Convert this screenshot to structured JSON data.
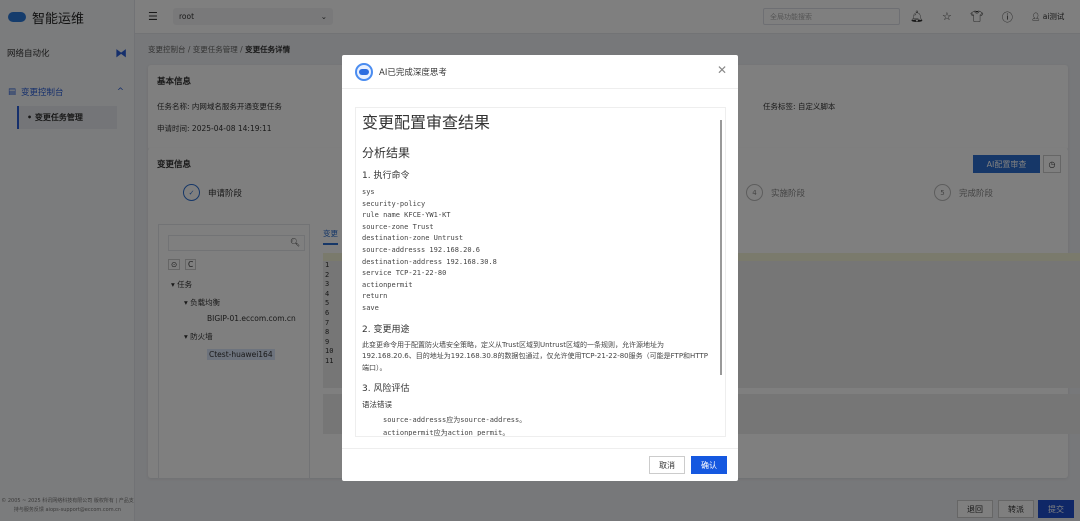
{
  "app": {
    "title": "智能运维",
    "section": "网络自动化",
    "footer": "© 2005 ~ 2025 科讯网络科技有限公司 版权所有 | 产品支持与服务反馈 aiops-support@eccom.com.cn"
  },
  "sidebar": {
    "group": "变更控制台",
    "item": "变更任务管理"
  },
  "topbar": {
    "tenant": "root",
    "search_placeholder": "全局功能搜索",
    "user": "ai测试"
  },
  "breadcrumb": [
    "变更控制台",
    "变更任务管理",
    "变更任务详情"
  ],
  "basic": {
    "title": "基本信息",
    "task_name_label": "任务名称:",
    "task_name": "内网域名服务开通变更任务",
    "time_label": "申请时间:",
    "time": "2025-04-08 14:19:11",
    "tag_label": "任务标签:",
    "tag": "自定义脚本"
  },
  "change": {
    "title": "变更信息",
    "ai_button": "AI配置审查",
    "steps": [
      {
        "num": "✓",
        "label": "申请阶段"
      },
      {
        "num": "4",
        "label": "实施阶段"
      },
      {
        "num": "5",
        "label": "完成阶段"
      }
    ],
    "tab": "变更"
  },
  "tree": {
    "root": "任务",
    "lb": "负载均衡",
    "lb_host": "BIGIP-01.eccom.com.cn",
    "fw": "防火墙",
    "fw_host": "Ctest-huawei164"
  },
  "line_numbers": [
    "1",
    "2",
    "3",
    "4",
    "5",
    "6",
    "7",
    "8",
    "9",
    "10",
    "11"
  ],
  "actions": {
    "back": "退回",
    "transfer": "转派",
    "submit": "提交"
  },
  "modal": {
    "title": "AI已完成深度思考",
    "heading": "变更配置审查结果",
    "analysis": "分析结果",
    "s1": "1. 执行命令",
    "commands": "sys\nsecurity-policy\nrule name KFCE-YW1-KT\nsource-zone Trust\ndestination-zone Untrust\nsource-addresss 192.168.20.6\ndestination-address 192.168.30.8\nservice TCP-21-22-80\nactionpermit\nreturn\nsave",
    "s2": "2. 变更用途",
    "purpose": "此变更命令用于配置防火墙安全策略，定义从Trust区域到Untrust区域的一条规则，允许源地址为192.168.20.6、目的地址为192.168.30.8的数据包通过，仅允许使用TCP-21-22-80服务（可能是FTP和HTTP端口）。",
    "s3": "3. 风险评估",
    "syntax": "语法错误",
    "err1": "source-addresss应为source-address。",
    "err2": "actionpermit应为action permit。",
    "cancel": "取消",
    "confirm": "确认"
  }
}
